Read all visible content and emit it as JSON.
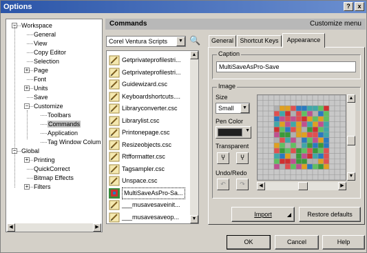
{
  "window": {
    "title": "Options",
    "help_btn": "?",
    "close_btn": "x"
  },
  "tree": {
    "items": [
      {
        "label": "Workspace",
        "level": 0,
        "expander": "-"
      },
      {
        "label": "General",
        "level": 1
      },
      {
        "label": "View",
        "level": 1
      },
      {
        "label": "Copy Editor",
        "level": 1
      },
      {
        "label": "Selection",
        "level": 1
      },
      {
        "label": "Page",
        "level": 1,
        "expander": "+"
      },
      {
        "label": "Font",
        "level": 1
      },
      {
        "label": "Units",
        "level": 1,
        "expander": "+"
      },
      {
        "label": "Save",
        "level": 1
      },
      {
        "label": "Customize",
        "level": 1,
        "expander": "-"
      },
      {
        "label": "Toolbars",
        "level": 2
      },
      {
        "label": "Commands",
        "level": 2,
        "selected": true
      },
      {
        "label": "Application",
        "level": 2
      },
      {
        "label": "Tag Window Colum",
        "level": 2
      },
      {
        "label": "Global",
        "level": 0,
        "expander": "-"
      },
      {
        "label": "Printing",
        "level": 1,
        "expander": "+"
      },
      {
        "label": "QuickCorrect",
        "level": 1
      },
      {
        "label": "Bitmap Effects",
        "level": 1
      },
      {
        "label": "Filters",
        "level": 1,
        "expander": "+"
      }
    ]
  },
  "header": {
    "title": "Commands",
    "customize_menu": "Customize menu"
  },
  "scripts_combo": {
    "value": "Corel Ventura Scripts"
  },
  "script_list": [
    {
      "label": "Getprivateprofilestri...",
      "icon": "script-icon"
    },
    {
      "label": "Getprivateprofilestri...",
      "icon": "script-icon"
    },
    {
      "label": "Guidewizard.csc",
      "icon": "script-icon"
    },
    {
      "label": "Keyboardshortcuts....",
      "icon": "script-icon"
    },
    {
      "label": "Libraryconverter.csc",
      "icon": "script-icon"
    },
    {
      "label": "Librarylist.csc",
      "icon": "script-icon"
    },
    {
      "label": "Printonepage.csc",
      "icon": "script-icon"
    },
    {
      "label": "Resizeobjects.csc",
      "icon": "script-icon"
    },
    {
      "label": "Rtfformatter.csc",
      "icon": "script-icon"
    },
    {
      "label": "Tagsampler.csc",
      "icon": "script-icon"
    },
    {
      "label": "Unspace.csc",
      "icon": "script-icon"
    },
    {
      "label": "MultiSaveAsPro-Sa...",
      "icon": "custom-image-icon",
      "selected": true
    },
    {
      "label": "___musavesaveinit...",
      "icon": "script-icon"
    },
    {
      "label": "___musavesaveop...",
      "icon": "script-icon"
    }
  ],
  "tabs": [
    "General",
    "Shortcut Keys",
    "Appearance"
  ],
  "active_tab": "Appearance",
  "caption": {
    "group": "Caption",
    "value": "MultiSaveAsPro-Save"
  },
  "image": {
    "group": "Image",
    "size_label": "Size",
    "size_value": "Small",
    "pen_color_label": "Pen Color",
    "pen_color": "#202020",
    "transparent_label": "Transparent",
    "undo_redo_label": "Undo/Redo"
  },
  "buttons": {
    "import": "Import",
    "restore": "Restore defaults",
    "ok": "OK",
    "cancel": "Cancel",
    "help": "Help"
  },
  "colors": {
    "title_start": "#2b55a8",
    "title_end": "#6b8fd0",
    "selection": "#c0c0c0",
    "dialog_bg": "#d4d0c8"
  }
}
